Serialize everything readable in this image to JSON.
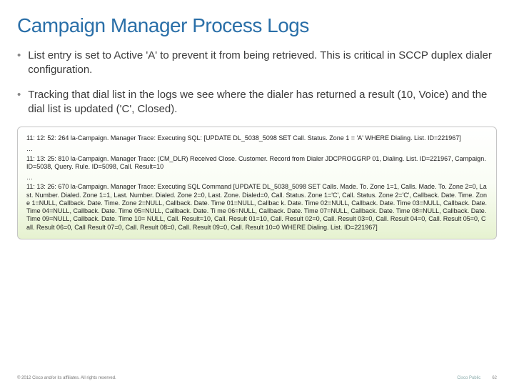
{
  "title": "Campaign Manager Process Logs",
  "bullets": [
    "List entry is set to Active 'A' to prevent it from being retrieved. This is critical in SCCP duplex dialer configuration.",
    "Tracking that dial list in the logs we see where the dialer has returned a result (10, Voice) and the dial list is updated ('C', Closed)."
  ],
  "log": {
    "line1": "11: 12: 52: 264 la-Campaign. Manager Trace: Executing SQL: [UPDATE DL_5038_5098 SET Call. Status. Zone 1 = 'A' WHERE Dialing. List. ID=221967]",
    "sep1": "…",
    "line2": "11: 13: 25: 810 la-Campaign. Manager Trace: (CM_DLR) Received Close. Customer. Record from Dialer JDCPROGGRP 01, Dialing. List. ID=221967, Campaign. ID=5038, Query. Rule. ID=5098, Call. Result=10",
    "sep2": "…",
    "line3": "11: 13: 26: 670 la-Campaign. Manager Trace: Executing SQL Command [UPDATE DL_5038_5098 SET Calls. Made. To. Zone 1=1, Calls. Made. To. Zone 2=0, Last. Number. Dialed. Zone 1=1, Last. Number. Dialed. Zone 2=0, Last. Zone. Dialed=0, Call. Status. Zone 1='C', Call. Status. Zone 2='C', Callback. Date. Time. Zone 1=NULL, Callback. Date. Time. Zone 2=NULL, Callback. Date. Time 01=NULL, Callbac k. Date. Time 02=NULL, Callback. Date. Time 03=NULL, Callback. Date. Time 04=NULL, Callback. Date. Time 05=NULL, Callback. Date. Ti me 06=NULL, Callback. Date. Time 07=NULL, Callback. Date. Time 08=NULL, Callback. Date. Time 09=NULL, Callback. Date. Time 10= NULL, Call. Result=10, Call. Result 01=10, Call. Result 02=0, Call. Result 03=0, Call. Result 04=0, Call. Result 05=0, Call. Result 06=0, Call Result 07=0, Call. Result 08=0, Call. Result 09=0, Call. Result 10=0 WHERE Dialing. List. ID=221967]"
  },
  "footer": {
    "copyright": "© 2012 Cisco and/or its affiliates. All rights reserved.",
    "classification": "Cisco Public",
    "page": "62"
  }
}
